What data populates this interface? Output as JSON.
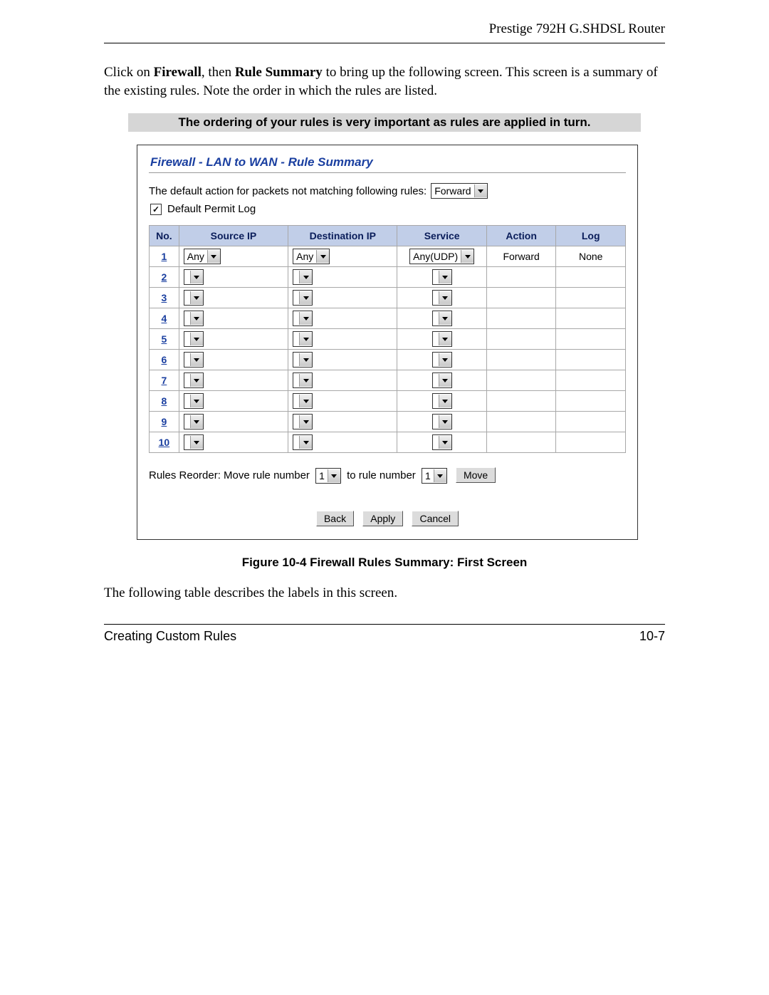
{
  "header": {
    "product": "Prestige 792H G.SHDSL Router"
  },
  "intro": {
    "p1": "Click on ",
    "b1": "Firewall",
    "p2": ", then ",
    "b2": "Rule Summary",
    "p3": " to bring up the following screen. This screen is a summary of the existing rules. Note the order in which the rules are listed."
  },
  "banner": "The ordering of your rules is very important as rules are applied in turn.",
  "panel": {
    "title": "Firewall - LAN to WAN - Rule Summary",
    "defaultActionLabel": "The default action for packets not matching following rules:",
    "defaultActionValue": "Forward",
    "permitLogChecked": true,
    "permitLogLabel": "Default Permit Log",
    "headers": [
      "No.",
      "Source IP",
      "Destination IP",
      "Service",
      "Action",
      "Log"
    ],
    "rows": [
      {
        "no": "1",
        "src": "Any",
        "dst": "Any",
        "srv": "Any(UDP)",
        "act": "Forward",
        "log": "None"
      },
      {
        "no": "2",
        "src": "",
        "dst": "",
        "srv": "",
        "act": "",
        "log": ""
      },
      {
        "no": "3",
        "src": "",
        "dst": "",
        "srv": "",
        "act": "",
        "log": ""
      },
      {
        "no": "4",
        "src": "",
        "dst": "",
        "srv": "",
        "act": "",
        "log": ""
      },
      {
        "no": "5",
        "src": "",
        "dst": "",
        "srv": "",
        "act": "",
        "log": ""
      },
      {
        "no": "6",
        "src": "",
        "dst": "",
        "srv": "",
        "act": "",
        "log": ""
      },
      {
        "no": "7",
        "src": "",
        "dst": "",
        "srv": "",
        "act": "",
        "log": ""
      },
      {
        "no": "8",
        "src": "",
        "dst": "",
        "srv": "",
        "act": "",
        "log": ""
      },
      {
        "no": "9",
        "src": "",
        "dst": "",
        "srv": "",
        "act": "",
        "log": ""
      },
      {
        "no": "10",
        "src": "",
        "dst": "",
        "srv": "",
        "act": "",
        "log": ""
      }
    ],
    "reorder": {
      "prefix": "Rules Reorder: Move rule number",
      "from": "1",
      "mid": "to rule number",
      "to": "1",
      "btn": "Move"
    },
    "buttons": {
      "back": "Back",
      "apply": "Apply",
      "cancel": "Cancel"
    }
  },
  "caption": "Figure 10-4 Firewall Rules Summary: First Screen",
  "follow": "The following table describes the labels in this screen.",
  "footer": {
    "left": "Creating Custom Rules",
    "right": "10-7"
  }
}
